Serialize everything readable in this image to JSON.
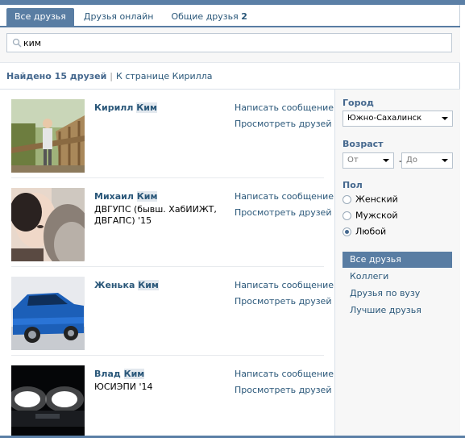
{
  "tabs": [
    {
      "label": "Все друзья"
    },
    {
      "label": "Друзья онлайн"
    },
    {
      "label": "Общие друзья",
      "count": "2"
    }
  ],
  "search": {
    "value": "ким",
    "icon": "search-icon"
  },
  "summary": {
    "found": "Найдено 15 друзей",
    "separator": "|",
    "link": "К странице Кирилла"
  },
  "friends": [
    {
      "first": "Кирилл",
      "last": "Ким",
      "edu": "",
      "actions": [
        "Написать сообщение",
        "Просмотреть друзей"
      ]
    },
    {
      "first": "Михаил",
      "last": "Ким",
      "edu": "ДВГУПС (бывш. ХабИИЖТ, ДВГАПС) '15",
      "actions": [
        "Написать сообщение",
        "Просмотреть друзей"
      ]
    },
    {
      "first": "Женька",
      "last": "Ким",
      "edu": "",
      "actions": [
        "Написать сообщение",
        "Просмотреть друзей"
      ]
    },
    {
      "first": "Влад",
      "last": "Ким",
      "edu": "ЮСИЭПИ '14",
      "actions": [
        "Написать сообщение",
        "Просмотреть друзей"
      ]
    }
  ],
  "filters": {
    "city_label": "Город",
    "city_value": "Южно-Сахалинск",
    "age_label": "Возраст",
    "age_from": "От",
    "age_dash": "-",
    "age_to": "До",
    "sex_label": "Пол",
    "sex_options": [
      {
        "label": "Женский",
        "selected": false
      },
      {
        "label": "Мужской",
        "selected": false
      },
      {
        "label": "Любой",
        "selected": true
      }
    ]
  },
  "menu": [
    {
      "label": "Все друзья",
      "active": true
    },
    {
      "label": "Коллеги",
      "active": false
    },
    {
      "label": "Друзья по вузу",
      "active": false
    },
    {
      "label": "Лучшие друзья",
      "active": false
    }
  ],
  "colors": {
    "accent": "#597da3",
    "link": "#2b587a",
    "header_text": "#45688e"
  }
}
